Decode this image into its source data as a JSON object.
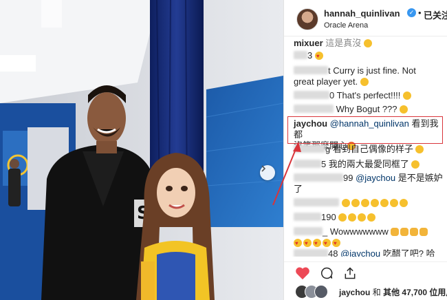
{
  "post": {
    "author": "hannah_quinlivan",
    "separator": "•",
    "follow_state": "已关注",
    "location": "Oracle Arena",
    "verified_mark": "✓"
  },
  "comments": [
    {
      "user": "mixuer",
      "text": "這是真沒"
    },
    {
      "text": "3"
    },
    {
      "text": "t Curry is just fine. Not"
    },
    {
      "text": "great player yet."
    },
    {
      "text": "0 That's perfect!!!!"
    },
    {
      "text": "Why Bogut ???"
    },
    {
      "user": "jaychou",
      "mention": "@hannah_quinlivan",
      "text": "看到我都"
    },
    {
      "text": "沒笑那麼開心"
    },
    {
      "text": "g 看到自己偶像的样子"
    },
    {
      "text": "5 我的兩大最愛同框了"
    },
    {
      "text": "99",
      "mention": "@jaychou",
      "text2": "是不是嫉妒"
    },
    {
      "text": "了"
    },
    {
      "text": "190"
    },
    {
      "text": "_ Wowwwwwww"
    },
    {
      "text": "48",
      "mention": "@jaychou",
      "text2": "吃醋了吧? 哈"
    }
  ],
  "likes": {
    "user": "jaychou",
    "connector": "和",
    "others": "其他 47,700 位用户"
  },
  "icons": {
    "like": "heart-icon",
    "comment": "comment-icon",
    "share": "share-icon",
    "next": "chevron-right-icon",
    "verified": "verified-badge-icon"
  },
  "colors": {
    "like_red": "#ed4956",
    "verified_blue": "#3897f0",
    "highlight_border": "#d9343a",
    "mention": "#003569"
  }
}
